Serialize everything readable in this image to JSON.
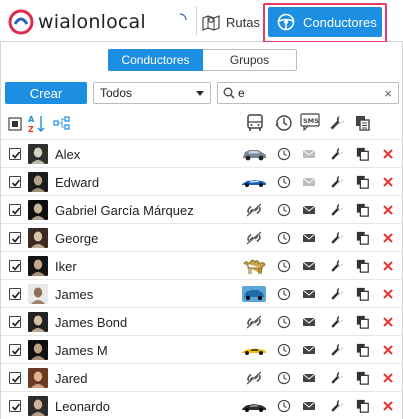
{
  "header": {
    "logo_wialon": "wialon",
    "logo_local": "local",
    "tabs": [
      {
        "label": "Rutas",
        "icon": "map-icon",
        "active": false
      },
      {
        "label": "Conductores",
        "icon": "steering-wheel-icon",
        "active": true
      }
    ]
  },
  "panel": {
    "segment": {
      "options": [
        "Conductores",
        "Grupos"
      ],
      "selected": "Conductores"
    },
    "create_label": "Crear",
    "filter": {
      "selected": "Todos"
    },
    "search": {
      "value": "e"
    },
    "columns": [
      "select-all",
      "sort-az",
      "hierarchy",
      "unit",
      "history",
      "sms",
      "properties",
      "copy",
      "delete"
    ]
  },
  "drivers": [
    {
      "name": "Alex",
      "checked": true,
      "unit": "car-gray",
      "sms_enabled": false
    },
    {
      "name": "Edward",
      "checked": true,
      "unit": "car-blue",
      "sms_enabled": false
    },
    {
      "name": "Gabriel García Márquez",
      "checked": true,
      "unit": "unbound",
      "sms_enabled": true
    },
    {
      "name": "George",
      "checked": true,
      "unit": "unbound",
      "sms_enabled": true
    },
    {
      "name": "Iker",
      "checked": true,
      "unit": "camel",
      "sms_enabled": true
    },
    {
      "name": "James",
      "checked": true,
      "unit": "car-teal",
      "sms_enabled": true
    },
    {
      "name": "James Bond",
      "checked": true,
      "unit": "unbound",
      "sms_enabled": true
    },
    {
      "name": "James M",
      "checked": true,
      "unit": "car-yellow",
      "sms_enabled": true
    },
    {
      "name": "Jared",
      "checked": true,
      "unit": "unbound",
      "sms_enabled": true
    },
    {
      "name": "Leonardo",
      "checked": true,
      "unit": "car-dark",
      "sms_enabled": true
    }
  ],
  "colors": {
    "accent": "#1c8fe2",
    "highlight": "#e43b6b",
    "delete": "#e53935"
  }
}
